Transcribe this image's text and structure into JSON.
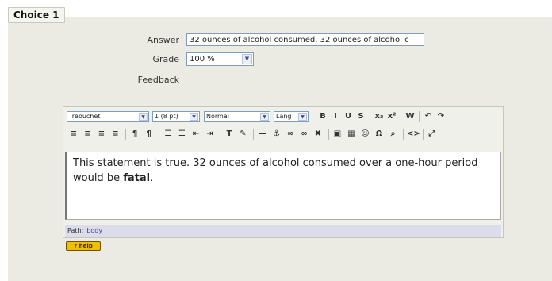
{
  "fieldset": {
    "legend": "Choice 1"
  },
  "form": {
    "answer_label": "Answer",
    "answer_value": "32 ounces of alcohol consumed. 32 ounces of alcohol c",
    "grade_label": "Grade",
    "grade_value": "100 %",
    "feedback_label": "Feedback"
  },
  "toolbar": {
    "font_family": "Trebuchet",
    "font_size": "1 (8 pt)",
    "format": "Normal",
    "lang": "Lang",
    "buttons_row1": [
      {
        "name": "bold-button",
        "glyph": "B"
      },
      {
        "name": "italic-button",
        "glyph": "I"
      },
      {
        "name": "underline-button",
        "glyph": "U"
      },
      {
        "name": "strikethrough-button",
        "glyph": "S"
      },
      {
        "name": "subscript-button",
        "glyph": "x₂"
      },
      {
        "name": "superscript-button",
        "glyph": "x²"
      },
      {
        "name": "clean-word-button",
        "glyph": "W"
      },
      {
        "name": "undo-button",
        "glyph": "↶"
      },
      {
        "name": "redo-button",
        "glyph": "↷"
      }
    ],
    "buttons_row2": [
      {
        "name": "align-left-button",
        "glyph": "≡"
      },
      {
        "name": "align-center-button",
        "glyph": "≡"
      },
      {
        "name": "align-right-button",
        "glyph": "≡"
      },
      {
        "name": "justify-button",
        "glyph": "≡"
      },
      {
        "name": "ltr-button",
        "glyph": "¶"
      },
      {
        "name": "rtl-button",
        "glyph": "¶"
      },
      {
        "name": "ordered-list-button",
        "glyph": "☰"
      },
      {
        "name": "unordered-list-button",
        "glyph": "☰"
      },
      {
        "name": "outdent-button",
        "glyph": "⇤"
      },
      {
        "name": "indent-button",
        "glyph": "⇥"
      },
      {
        "name": "text-color-button",
        "glyph": "T"
      },
      {
        "name": "background-color-button",
        "glyph": "✎"
      },
      {
        "name": "horizontal-rule-button",
        "glyph": "—"
      },
      {
        "name": "anchor-button",
        "glyph": "⚓"
      },
      {
        "name": "link-button",
        "glyph": "∞"
      },
      {
        "name": "unlink-button",
        "glyph": "∞"
      },
      {
        "name": "no-link-button",
        "glyph": "✖"
      },
      {
        "name": "image-button",
        "glyph": "▣"
      },
      {
        "name": "table-button",
        "glyph": "▦"
      },
      {
        "name": "smiley-button",
        "glyph": "☺"
      },
      {
        "name": "special-char-button",
        "glyph": "Ω"
      },
      {
        "name": "search-replace-button",
        "glyph": "⌕"
      },
      {
        "name": "html-source-button",
        "glyph": "<>"
      },
      {
        "name": "fullscreen-button",
        "glyph": "⤢"
      }
    ]
  },
  "editor": {
    "text_before": "This statement is true. 32 ounces of alcohol consumed over a one-hour period would be ",
    "text_bold": "fatal",
    "text_after": "."
  },
  "path_bar": {
    "label": "Path:",
    "value": "body"
  },
  "help": {
    "label": "? help"
  }
}
